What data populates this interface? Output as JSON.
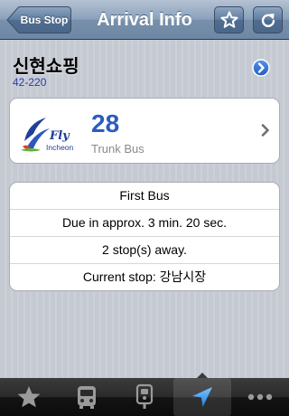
{
  "navbar": {
    "back_label": "Bus Stop",
    "title": "Arrival Info",
    "favorite_icon": "star-icon",
    "refresh_icon": "refresh-icon"
  },
  "stop": {
    "name": "신현쇼핑",
    "code": "42-220",
    "detail_icon": "disclosure-icon"
  },
  "bus": {
    "logo_text_fly": "Fly",
    "logo_text_city": "Incheon",
    "number": "28",
    "type": "Trunk Bus",
    "chevron_icon": "chevron-right-icon"
  },
  "arrival": {
    "rows": [
      "First Bus",
      "Due in approx. 3 min. 20 sec.",
      "2 stop(s) away.",
      "Current stop: 강남시장"
    ]
  },
  "tabbar": {
    "tabs": [
      {
        "icon": "star-icon",
        "active": false
      },
      {
        "icon": "bus-icon",
        "active": false
      },
      {
        "icon": "bus-stop-icon",
        "active": false
      },
      {
        "icon": "location-arrow-icon",
        "active": true
      },
      {
        "icon": "more-icon",
        "active": false
      }
    ]
  },
  "colors": {
    "accent_blue": "#2c5cbf",
    "code_blue": "#283ca8",
    "disclosure_blue": "#2f6fd6"
  }
}
